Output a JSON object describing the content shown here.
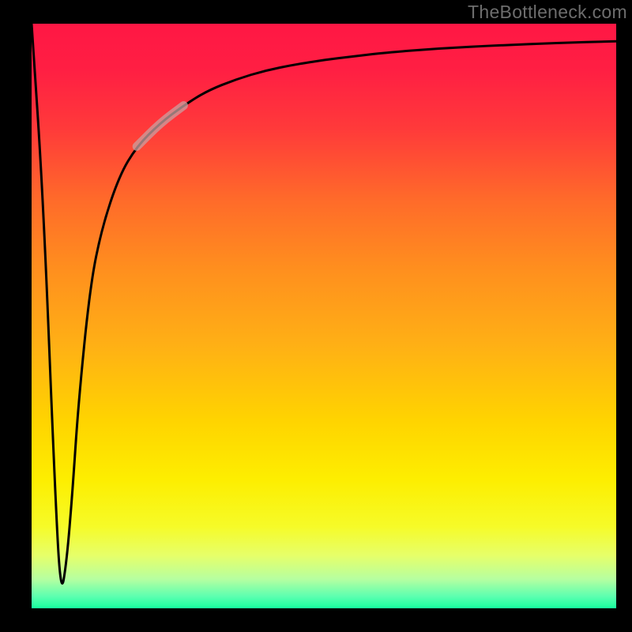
{
  "watermark": "TheBottleneck.com",
  "colors": {
    "frame": "#000000",
    "gradient_stops": [
      {
        "offset": 0.0,
        "color": "#ff1744"
      },
      {
        "offset": 0.08,
        "color": "#ff1f43"
      },
      {
        "offset": 0.18,
        "color": "#ff3a3a"
      },
      {
        "offset": 0.3,
        "color": "#ff6a2a"
      },
      {
        "offset": 0.42,
        "color": "#ff8f1e"
      },
      {
        "offset": 0.55,
        "color": "#ffb015"
      },
      {
        "offset": 0.68,
        "color": "#ffd400"
      },
      {
        "offset": 0.78,
        "color": "#fdee00"
      },
      {
        "offset": 0.86,
        "color": "#f6fb28"
      },
      {
        "offset": 0.91,
        "color": "#e6ff6a"
      },
      {
        "offset": 0.95,
        "color": "#b6ffa0"
      },
      {
        "offset": 0.98,
        "color": "#5bffb0"
      },
      {
        "offset": 1.0,
        "color": "#17ff9e"
      }
    ],
    "curve": "#000000",
    "highlight": "#c9a0a0"
  },
  "chart_data": {
    "type": "line",
    "title": "",
    "xlabel": "",
    "ylabel": "",
    "xlim": [
      0,
      100
    ],
    "ylim": [
      0,
      100
    ],
    "grid": false,
    "legend": false,
    "series": [
      {
        "name": "bottleneck-curve",
        "x": [
          0,
          2,
          4,
          5,
          6,
          7,
          8,
          10,
          12,
          15,
          18,
          22,
          26,
          30,
          35,
          40,
          45,
          50,
          55,
          60,
          70,
          80,
          90,
          100
        ],
        "y": [
          100,
          70,
          20,
          2,
          8,
          20,
          35,
          55,
          65,
          74,
          79,
          83,
          86,
          88.5,
          90.5,
          92,
          93,
          93.8,
          94.4,
          95,
          95.8,
          96.3,
          96.7,
          97
        ]
      }
    ],
    "highlight_segment": {
      "x_start": 18,
      "x_end": 26
    },
    "notes": "Values are visual estimates read from the unlabeled axes (0–100 each). The curve drops sharply from y≈100 at x≈0 to a minimum y≈2 near x≈5, then rises and asymptotes toward y≈97 at x=100. The pale segment marks roughly x∈[18,26]."
  }
}
